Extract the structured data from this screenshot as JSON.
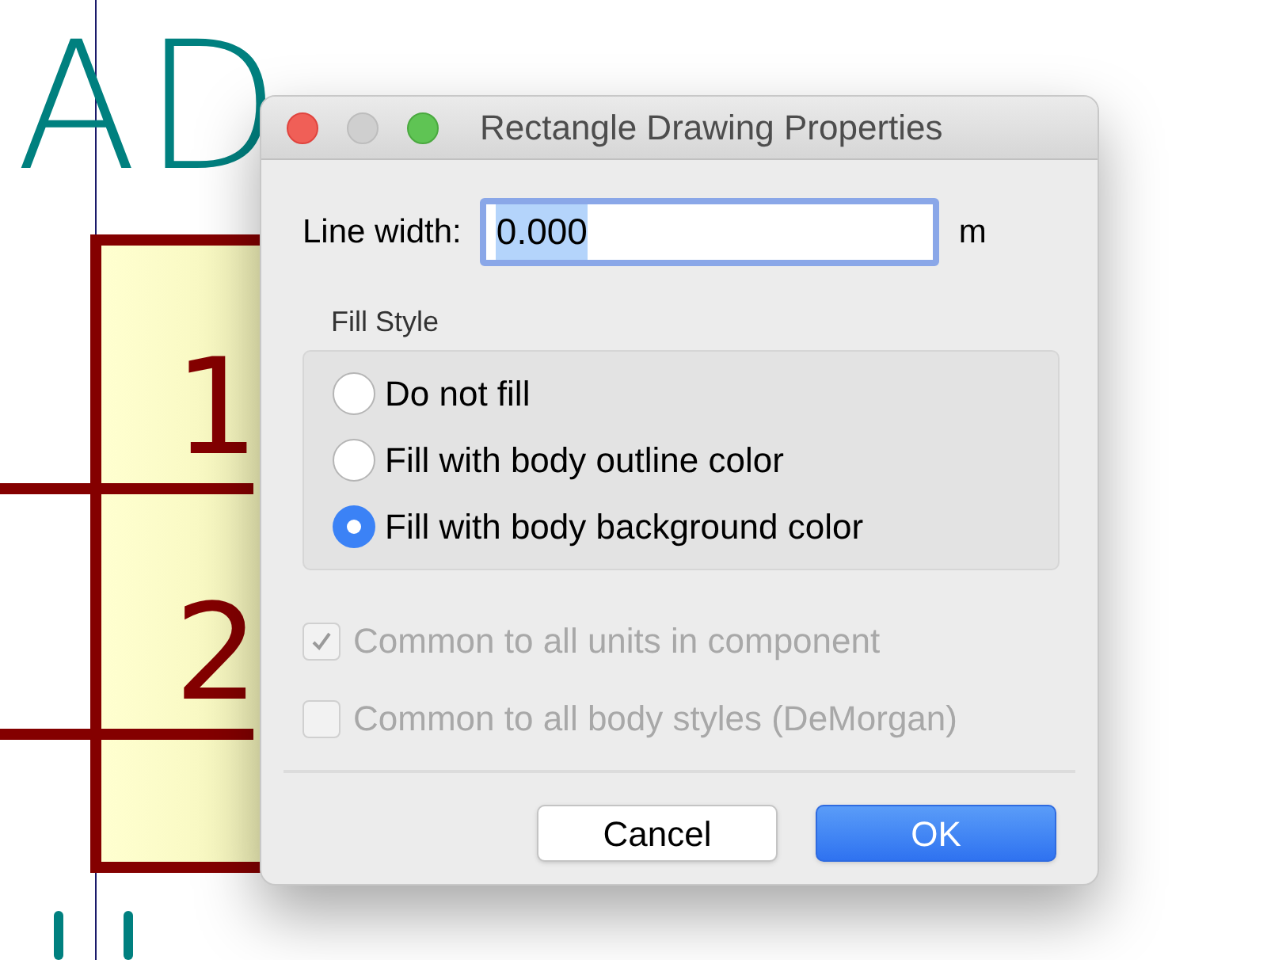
{
  "canvas": {
    "reference_text": "AD",
    "pins": [
      {
        "number": "1"
      },
      {
        "number": "2"
      }
    ]
  },
  "dialog": {
    "title": "Rectangle Drawing Properties",
    "line_width": {
      "label": "Line width:",
      "value": "0.000",
      "unit": "m"
    },
    "fill_style": {
      "title": "Fill Style",
      "options": [
        {
          "label": "Do not fill",
          "selected": false
        },
        {
          "label": "Fill with body outline color",
          "selected": false
        },
        {
          "label": "Fill with body background color",
          "selected": true
        }
      ]
    },
    "checkboxes": [
      {
        "label": "Common to all units in component",
        "checked": true,
        "disabled": true
      },
      {
        "label": "Common to all body styles (DeMorgan)",
        "checked": false,
        "disabled": true
      }
    ],
    "buttons": [
      {
        "label": "Cancel",
        "kind": "secondary"
      },
      {
        "label": "OK",
        "kind": "primary"
      }
    ]
  }
}
